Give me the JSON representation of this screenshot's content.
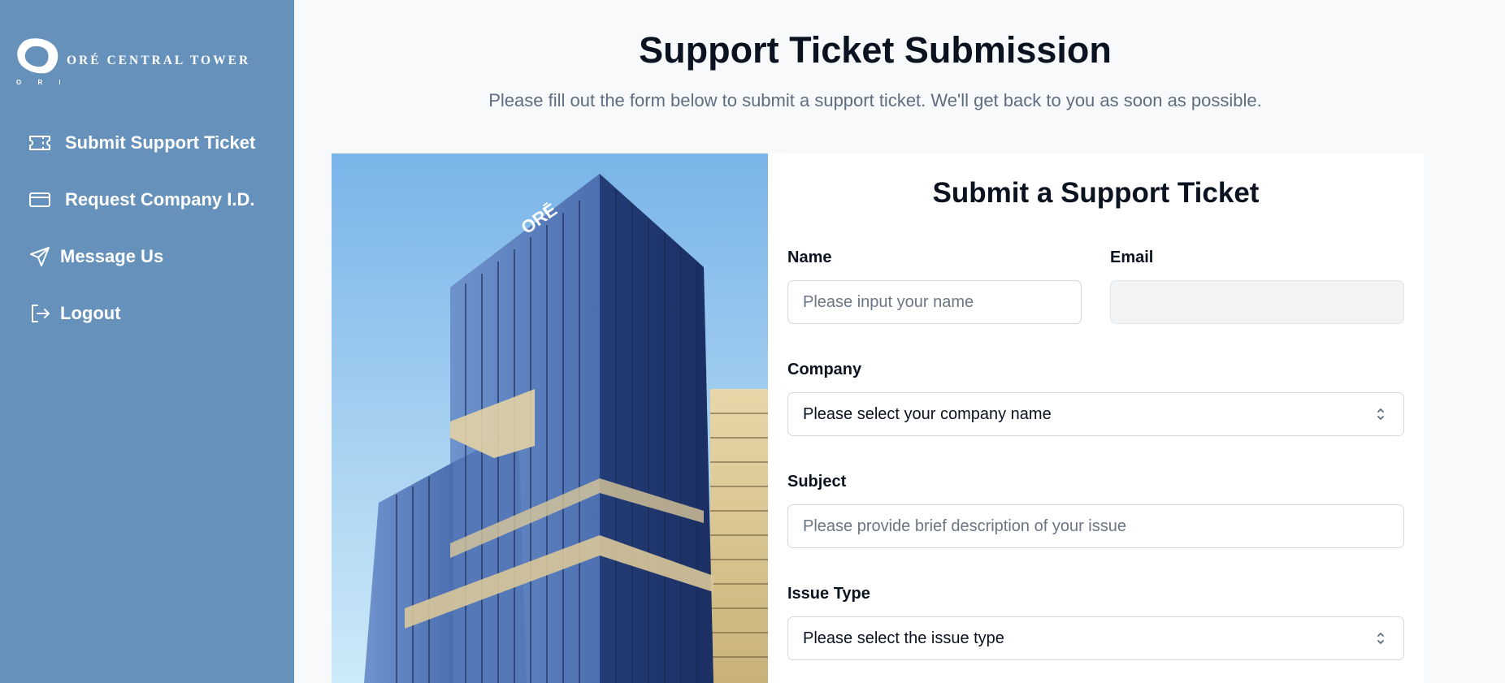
{
  "brand": {
    "name": "ORÉ CENTRAL TOWER",
    "mark_caption": "O R Ē"
  },
  "sidebar": {
    "items": [
      {
        "label": "Submit Support Ticket",
        "icon": "ticket-icon"
      },
      {
        "label": "Request Company I.D.",
        "icon": "id-card-icon"
      },
      {
        "label": "Message Us",
        "icon": "send-icon"
      },
      {
        "label": "Logout",
        "icon": "logout-icon"
      }
    ]
  },
  "page": {
    "title": "Support Ticket Submission",
    "subtitle": "Please fill out the form below to submit a support ticket. We'll get back to you as soon as possible."
  },
  "hero": {
    "building_sign": "ORĒ"
  },
  "form": {
    "title": "Submit a Support Ticket",
    "name": {
      "label": "Name",
      "placeholder": "Please input your name"
    },
    "email": {
      "label": "Email",
      "value": ""
    },
    "company": {
      "label": "Company",
      "selected": "Please select your company name"
    },
    "subject": {
      "label": "Subject",
      "placeholder": "Please provide brief description of your issue"
    },
    "issue_type": {
      "label": "Issue Type",
      "selected": "Please select the issue type"
    }
  },
  "colors": {
    "sidebar_bg": "#6591bb",
    "page_bg": "#f7f9fb",
    "title_text": "#0b1220",
    "subtitle_text": "#5f6d80"
  }
}
